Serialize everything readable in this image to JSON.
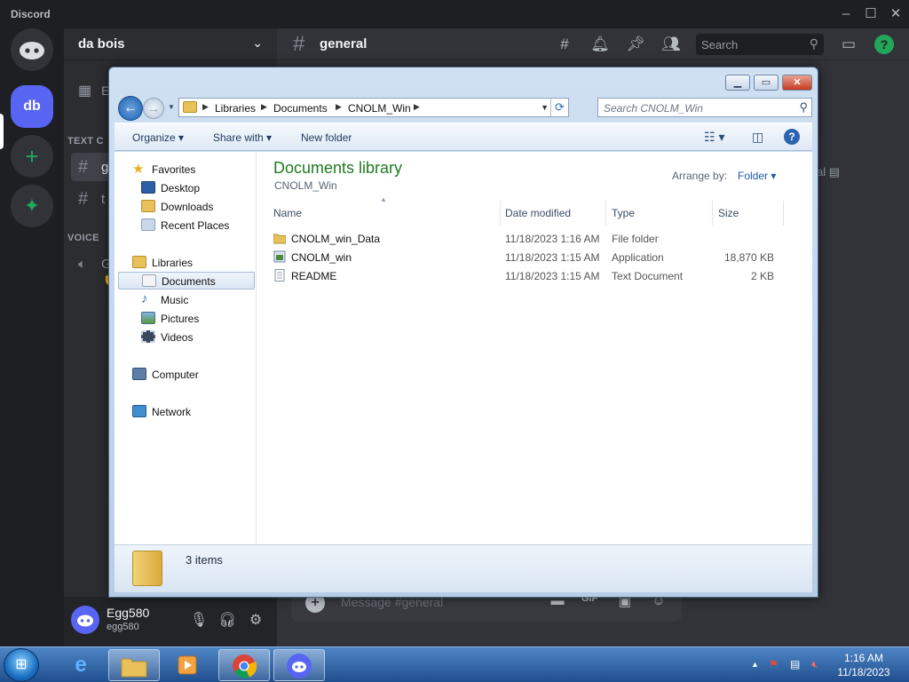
{
  "discord": {
    "app_name": "Discord",
    "server_name": "da bois",
    "server_icon": "db",
    "events_label": "E",
    "categories": {
      "text": "TEXT C",
      "voice": "VOICE"
    },
    "channels": {
      "text1": "g",
      "text2": "t",
      "voice1": "G"
    },
    "channel_title": "general",
    "search_placeholder": "Search",
    "member_peek": "al",
    "user": {
      "name": "Egg580",
      "tag": "egg580"
    },
    "message_placeholder": "Message #general",
    "gif_label": "GIF",
    "accent": "#5865f2",
    "green": "#23a55a"
  },
  "explorer": {
    "address": [
      "Libraries",
      "Documents",
      "CNOLM_Win"
    ],
    "search_placeholder": "Search CNOLM_Win",
    "toolbar": {
      "organize": "Organize",
      "share_with": "Share with",
      "new_folder": "New folder"
    },
    "nav": {
      "favorites": "Favorites",
      "desktop": "Desktop",
      "downloads": "Downloads",
      "recent_places": "Recent Places",
      "libraries": "Libraries",
      "documents": "Documents",
      "music": "Music",
      "pictures": "Pictures",
      "videos": "Videos",
      "computer": "Computer",
      "network": "Network"
    },
    "library_title": "Documents library",
    "library_subtitle": "CNOLM_Win",
    "arrange_by_label": "Arrange by:",
    "arrange_by_value": "Folder",
    "columns": {
      "name": "Name",
      "date": "Date modified",
      "type": "Type",
      "size": "Size"
    },
    "files": [
      {
        "name": "CNOLM_win_Data",
        "date": "11/18/2023 1:16 AM",
        "type": "File folder",
        "size": "",
        "icon": "folder-icon"
      },
      {
        "name": "CNOLM_win",
        "date": "11/18/2023 1:15 AM",
        "type": "Application",
        "size": "18,870 KB",
        "icon": "application-icon"
      },
      {
        "name": "README",
        "date": "11/18/2023 1:15 AM",
        "type": "Text Document",
        "size": "2 KB",
        "icon": "text-document-icon"
      }
    ],
    "status": "3 items"
  },
  "taskbar": {
    "clock_time": "1:16 AM",
    "clock_date": "11/18/2023"
  }
}
